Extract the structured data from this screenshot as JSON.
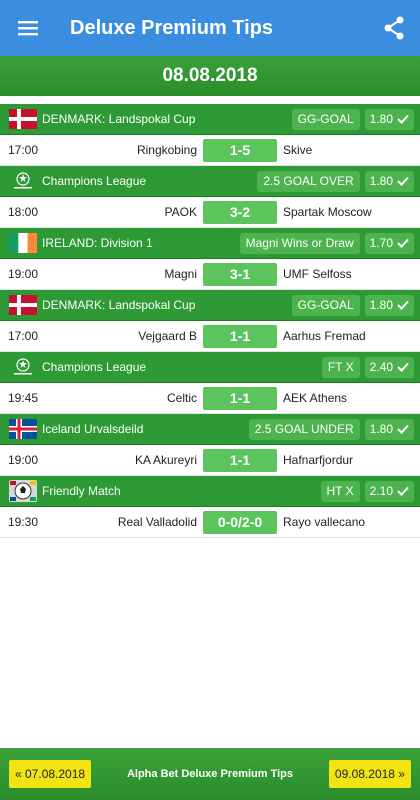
{
  "app": {
    "title": "Deluxe Premium Tips",
    "accent": "#3b8de0",
    "green": "#2e9a36"
  },
  "date": "08.08.2018",
  "tips": [
    {
      "league": "DENMARK: Landspokal Cup",
      "logo": "denmark-flag-icon",
      "tip": "GG-GOAL",
      "odd": "1.80",
      "time": "17:00",
      "home": "Ringkobing",
      "score": "1-5",
      "away": "Skive"
    },
    {
      "league": "Champions League",
      "logo": "champions-league-icon",
      "tip": "2.5 GOAL OVER",
      "odd": "1.80",
      "time": "18:00",
      "home": "PAOK",
      "score": "3-2",
      "away": "Spartak Moscow"
    },
    {
      "league": "IRELAND: Division 1",
      "logo": "ireland-flag-icon",
      "tip": "Magni Wins or Draw",
      "odd": "1.70",
      "time": "19:00",
      "home": "Magni",
      "score": "3-1",
      "away": "UMF Selfoss"
    },
    {
      "league": "DENMARK: Landspokal Cup",
      "logo": "denmark-flag-icon",
      "tip": "GG-GOAL",
      "odd": "1.80",
      "time": "17:00",
      "home": "Vejgaard B",
      "score": "1-1",
      "away": "Aarhus Fremad"
    },
    {
      "league": "Champions League",
      "logo": "champions-league-icon",
      "tip": "FT X",
      "odd": "2.40",
      "time": "19:45",
      "home": "Celtic",
      "score": "1-1",
      "away": "AEK Athens"
    },
    {
      "league": "Iceland Urvalsdeild",
      "logo": "iceland-flag-icon",
      "tip": "2.5 GOAL UNDER",
      "odd": "1.80",
      "time": "19:00",
      "home": "KA Akureyri",
      "score": "1-1",
      "away": "Hafnarfjordur"
    },
    {
      "league": "Friendly Match",
      "logo": "friendly-match-icon",
      "tip": "HT X",
      "odd": "2.10",
      "time": "19:30",
      "home": "Real Valladolid",
      "score": "0-0/2-0",
      "away": "Rayo vallecano"
    }
  ],
  "footer": {
    "prev": "« 07.08.2018",
    "title": "Alpha Bet Deluxe Premium Tips",
    "next": "09.08.2018 »"
  }
}
